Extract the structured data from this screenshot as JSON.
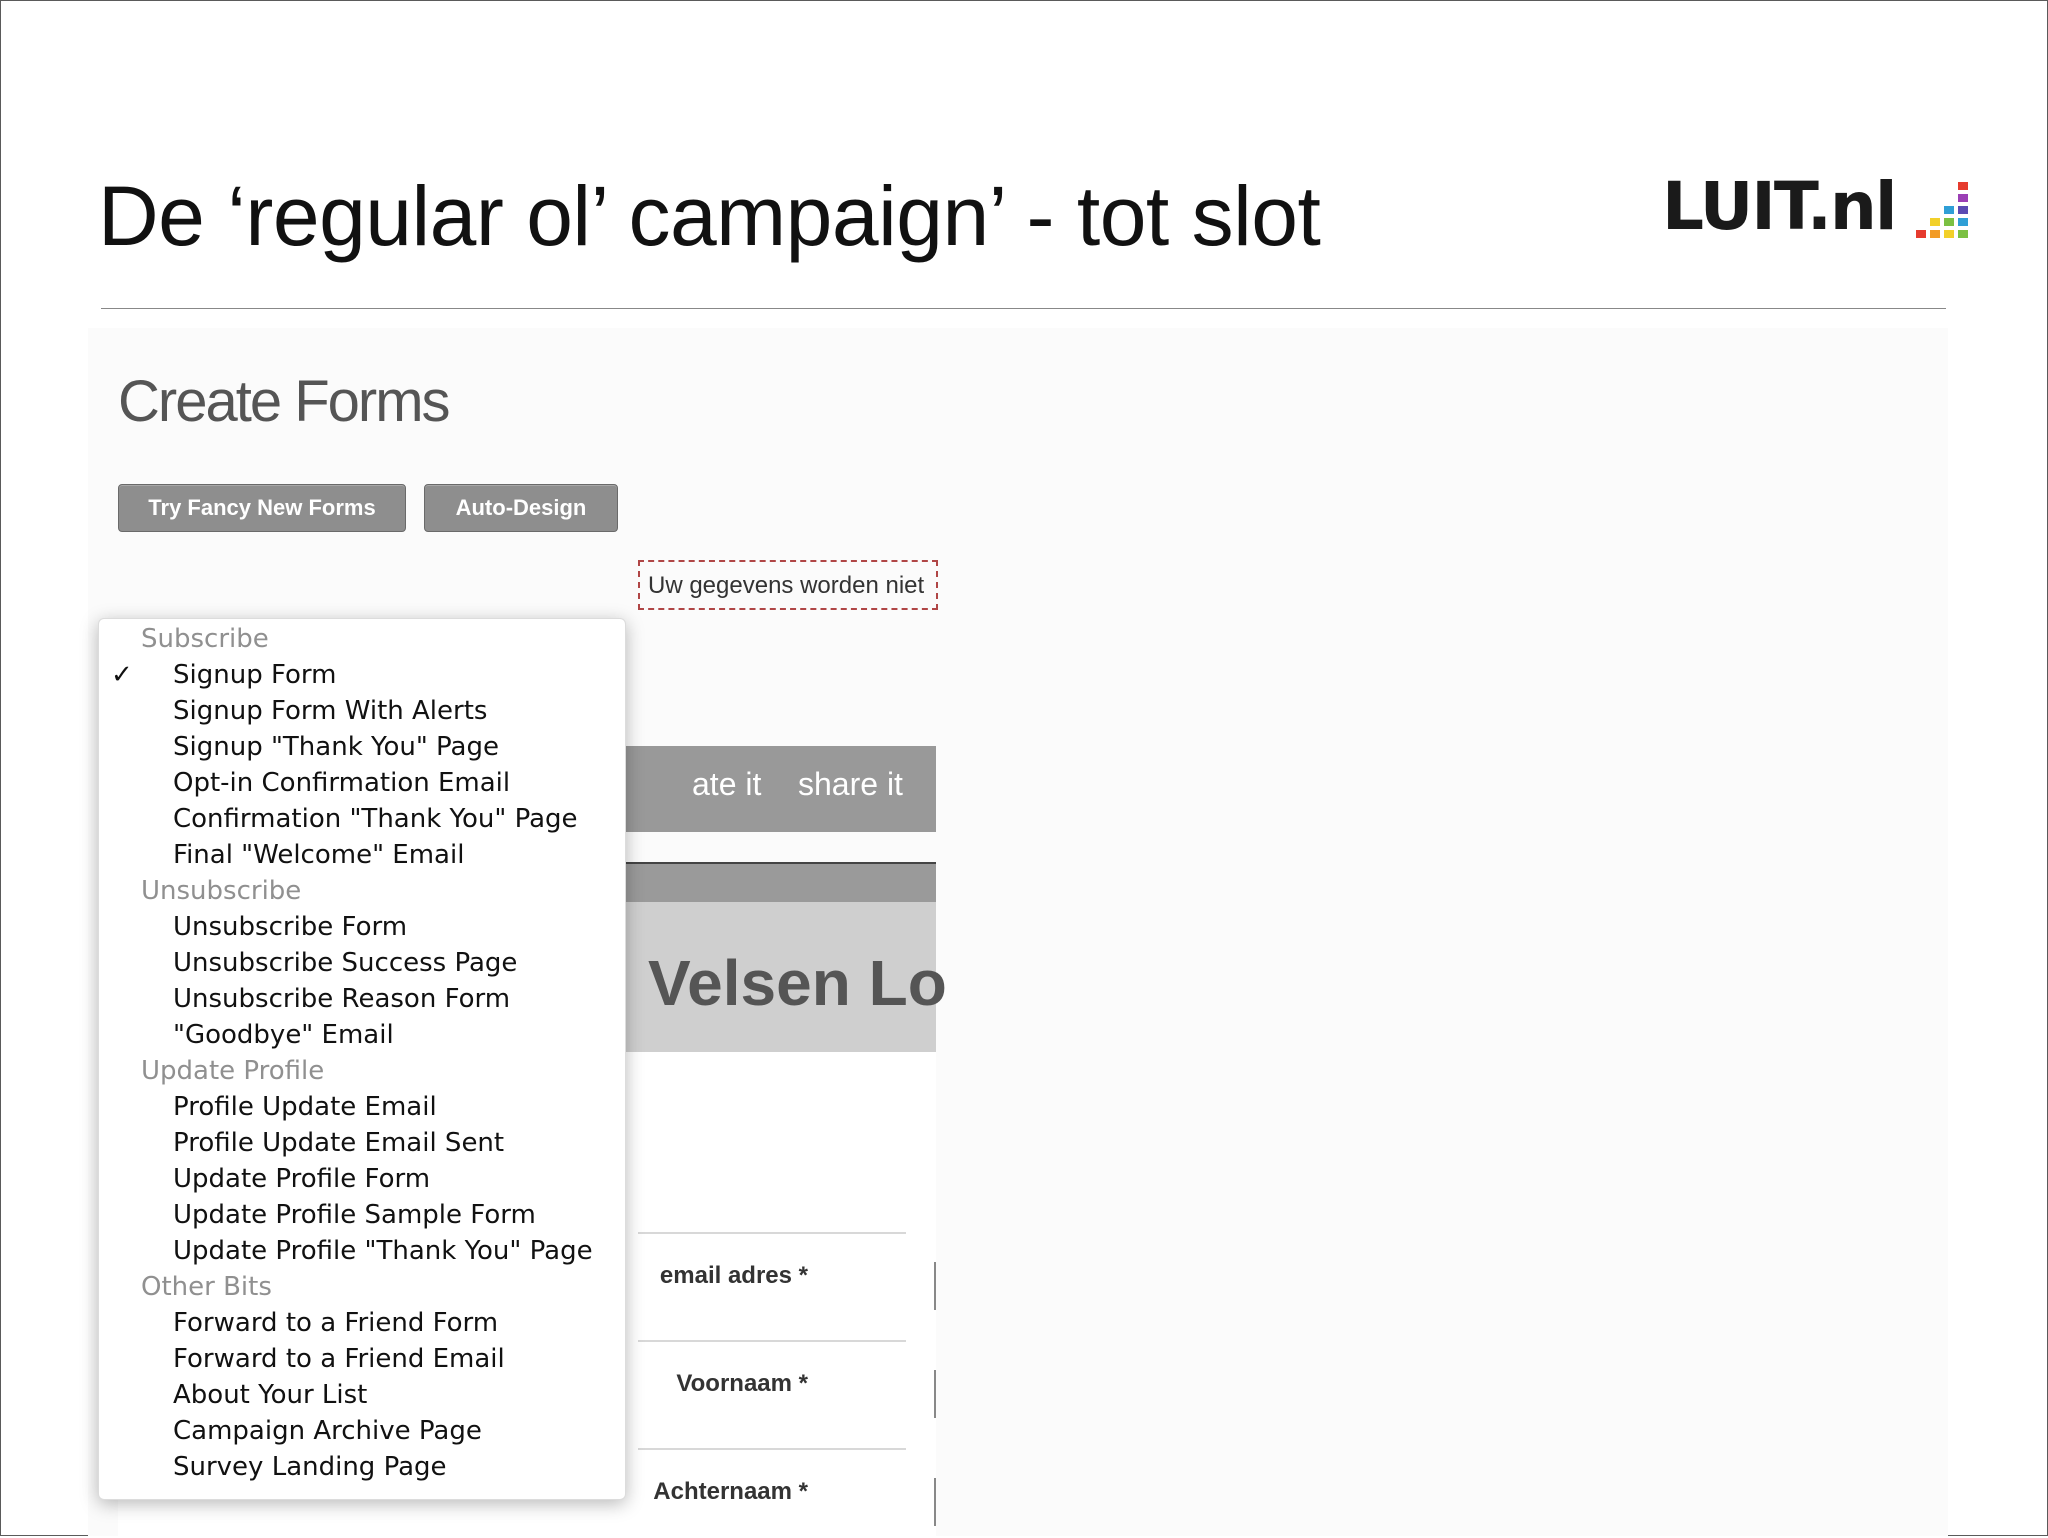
{
  "slide": {
    "title": "De ‘regular ol’ campaign’ - tot slot",
    "logo_text": "LUIT.nl"
  },
  "shot": {
    "heading": "Create Forms",
    "buttons": {
      "fancy": "Try Fancy New Forms",
      "auto": "Auto-Design"
    },
    "tabs": {
      "create": "ate it",
      "share": "share it"
    },
    "header_title": "Velsen Lo",
    "notice": "Uw gegevens worden niet",
    "fields": {
      "email": "email adres *",
      "firstname": "Voornaam *",
      "lastname": "Achternaam *"
    }
  },
  "menu": {
    "selected": "Signup Form",
    "check_glyph": "✓",
    "groups": [
      {
        "header": "Subscribe",
        "items": [
          "Signup Form",
          "Signup Form With Alerts",
          "Signup \"Thank You\" Page",
          "Opt-in Confirmation Email",
          "Confirmation \"Thank You\" Page",
          "Final \"Welcome\" Email"
        ]
      },
      {
        "header": "Unsubscribe",
        "items": [
          "Unsubscribe Form",
          "Unsubscribe Success Page",
          "Unsubscribe Reason Form",
          "\"Goodbye\" Email"
        ]
      },
      {
        "header": "Update Profile",
        "items": [
          "Profile Update Email",
          "Profile Update Email Sent",
          "Update Profile Form",
          "Update Profile Sample Form",
          "Update Profile \"Thank You\" Page"
        ]
      },
      {
        "header": "Other Bits",
        "items": [
          "Forward to a Friend Form",
          "Forward to a Friend Email",
          "About Your List",
          "Campaign Archive Page",
          "Survey Landing Page"
        ]
      }
    ]
  },
  "colors": {
    "logo_bar_colors": [
      "#e63b2e",
      "#f29b26",
      "#f2d02a",
      "#7bc043",
      "#2f9fd6",
      "#5b4bb3",
      "#9b3fb5"
    ]
  }
}
